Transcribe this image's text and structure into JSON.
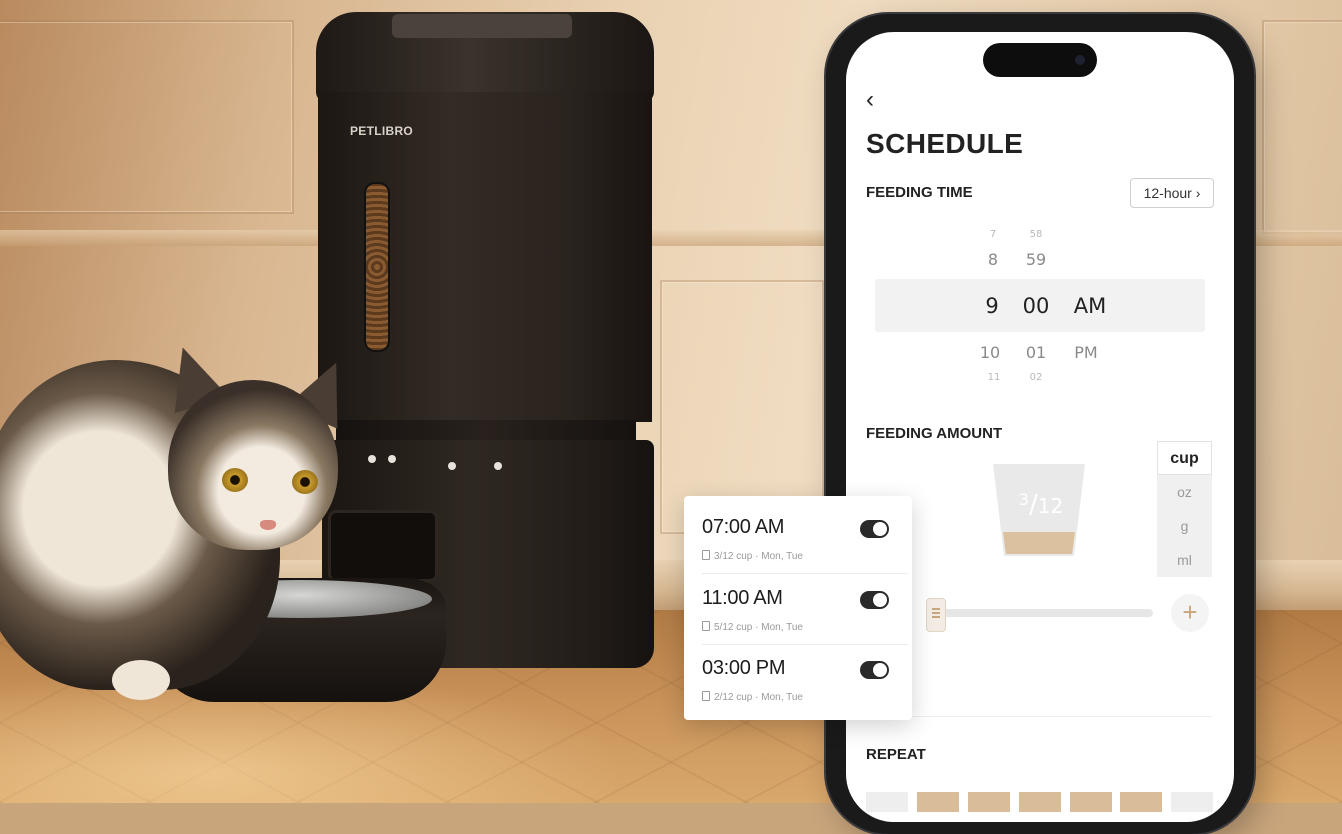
{
  "brand": "PETLIBRO",
  "schedule_screen": {
    "title": "SCHEDULE",
    "feeding_time": {
      "label": "FEEDING TIME",
      "format_button": "12-hour ›",
      "picker": {
        "hours": [
          "8",
          "9",
          "10"
        ],
        "minutes": [
          "59",
          "00",
          "01"
        ],
        "periods": [
          "AM",
          "PM"
        ],
        "selected": {
          "hour": "9",
          "minute": "00",
          "period": "AM"
        }
      }
    },
    "feeding_amount": {
      "label": "FEEDING AMOUNT",
      "numerator": "3",
      "denominator": "12",
      "fill_fraction": 0.25,
      "units": [
        "cup",
        "oz",
        "g",
        "ml"
      ],
      "selected_unit": "cup"
    },
    "repeat": {
      "label": "REPEAT"
    }
  },
  "schedule_list": [
    {
      "time": "07:00 AM",
      "detail": "3/12 cup · Mon, Tue",
      "enabled": true
    },
    {
      "time": "11:00 AM",
      "detail": "5/12 cup · Mon, Tue",
      "enabled": true
    },
    {
      "time": "03:00 PM",
      "detail": "2/12 cup · Mon, Tue",
      "enabled": true
    }
  ],
  "colors": {
    "accent": "#c9a57c",
    "toggle_on": "#2a2a2a"
  }
}
